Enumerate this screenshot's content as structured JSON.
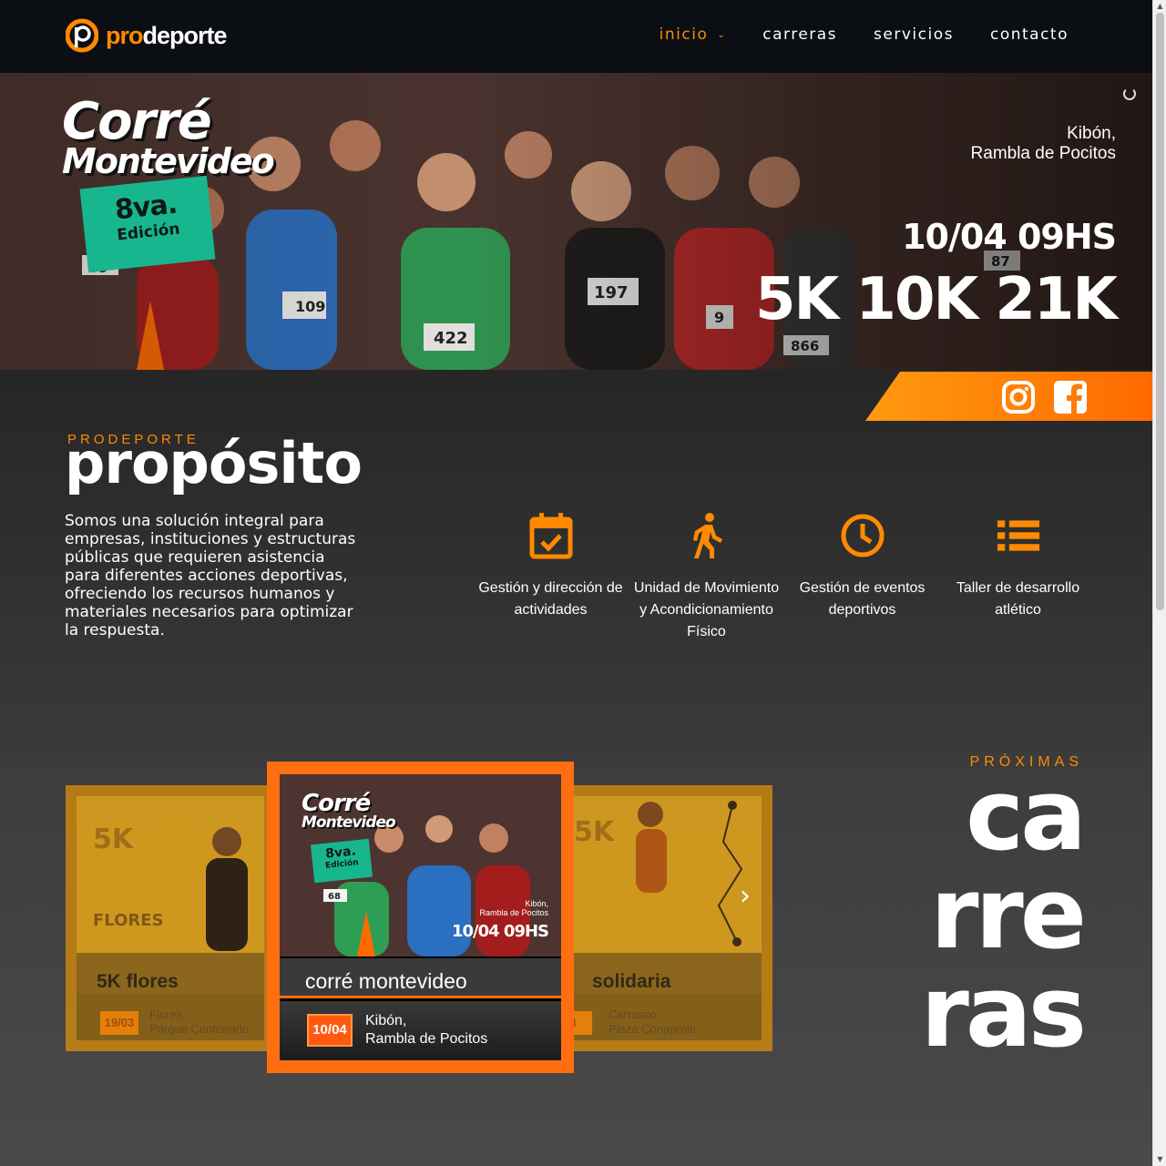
{
  "brand": {
    "logo_pro": "pro",
    "logo_deporte": "deporte",
    "accent": "#ff8a00"
  },
  "nav": {
    "items": [
      {
        "label": "inicio",
        "active": true,
        "has_dropdown": true
      },
      {
        "label": "carreras"
      },
      {
        "label": "servicios"
      },
      {
        "label": "contacto"
      }
    ]
  },
  "hero": {
    "title_line1": "Corré",
    "title_line2": "Montevideo",
    "edition_line1": "8va.",
    "edition_line2": "Edición",
    "place_line1": "Kibón,",
    "place_line2": "Rambla de Pocitos",
    "datetime": "10/04 09HS",
    "distances": "5K 10K 21K",
    "bibs": [
      "68",
      "109",
      "422",
      "197",
      "866",
      "87",
      "9"
    ]
  },
  "social": {
    "instagram": "instagram-icon",
    "facebook": "facebook-icon"
  },
  "purpose": {
    "kicker": "PRODEPORTE",
    "title": "propósito",
    "text": "Somos una solución integral para empresas, instituciones y estructuras públicas que requieren asistencia para diferentes acciones deportivas, ofreciendo los recursos humanos y materiales necesarios para optimizar la respuesta.",
    "services": [
      {
        "icon": "calendar-check-icon",
        "label": "Gestión y dirección de actividades"
      },
      {
        "icon": "walking-person-icon",
        "label": "Unidad de Movimiento y Acondicionamiento Físico"
      },
      {
        "icon": "clock-icon",
        "label": "Gestión de eventos deportivos"
      },
      {
        "icon": "list-icon",
        "label": "Taller de desarrollo atlético"
      }
    ]
  },
  "races": {
    "kicker": "PRÓXIMAS",
    "title_l1": "ca",
    "title_l2": "rre",
    "title_l3": "ras",
    "cards": [
      {
        "name": "5K flores",
        "date": "19/03",
        "place_line1": "Flores,",
        "place_line2": "Parque Centenario",
        "tag": "5K",
        "sub": "FLORES"
      },
      {
        "name": "corré montevideo",
        "date": "10/04",
        "place_line1": "Kibón,",
        "place_line2": "Rambla de Pocitos",
        "poster_title1": "Corré",
        "poster_title2": "Montevideo",
        "poster_ed1": "8va.",
        "poster_ed2": "Edición",
        "poster_place1": "Kibón,",
        "poster_place2": "Rambla de Pocitos",
        "poster_datetime": "10/04 09HS",
        "poster_bib": "68"
      },
      {
        "name": "solidaria",
        "date": "4",
        "place_line1": "Carrasco,",
        "place_line2": "Plaza Conaprole",
        "tag": "5K"
      }
    ],
    "next_arrow": "›"
  }
}
